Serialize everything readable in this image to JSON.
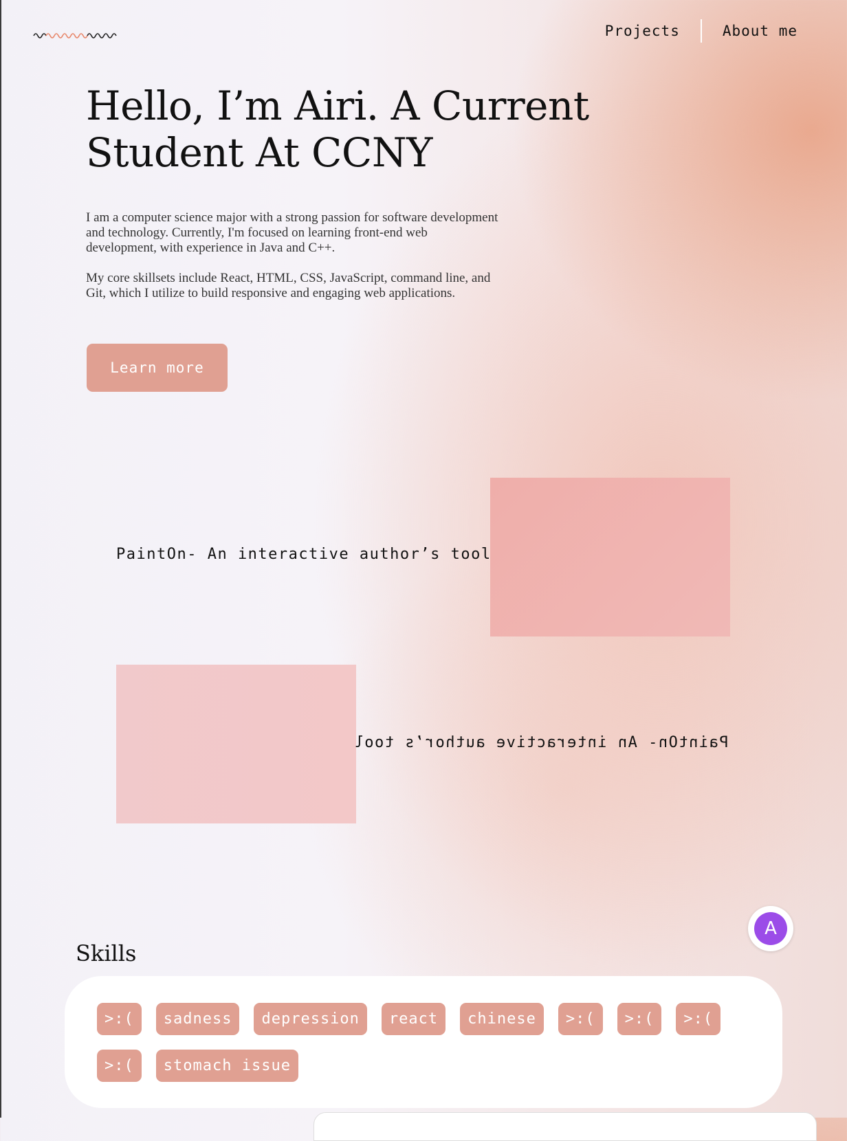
{
  "header": {
    "logo_icon": "squiggle-signature-logo",
    "logo_colors": [
      "#222222",
      "#e8876a"
    ],
    "nav": [
      {
        "label": "Projects"
      },
      {
        "label": "About me"
      }
    ]
  },
  "hero": {
    "title": "Hello, I’m Airi. A Current Student At CCNY",
    "paragraph_1": "I am a computer science major with a strong passion for software development and technology. Currently, I'm focused on learning front-end web development, with experience in Java and C++.",
    "paragraph_2": "My core skillsets include React, HTML, CSS, JavaScript, command line, and Git, which I utilize to build responsive and engaging web applications.",
    "cta_label": "Learn more"
  },
  "projects": [
    {
      "title": "PaintOn- An interactive author’s tool",
      "mirrored": false,
      "image_color": "#efb3b0"
    },
    {
      "title": "PaintOn- An interactive author’s tool",
      "mirrored": true,
      "image_color": "#f2c8ca"
    }
  ],
  "avatar": {
    "initial": "A",
    "color": "#9b4ce8"
  },
  "skills": {
    "title": "Skills",
    "tag_color": "#e0a092",
    "row_1": [
      ">:(",
      "sadness",
      "depression",
      "react",
      "chinese",
      ">:(",
      ">:(",
      ">:("
    ],
    "row_2": [
      ">:(",
      "stomach issue"
    ]
  }
}
